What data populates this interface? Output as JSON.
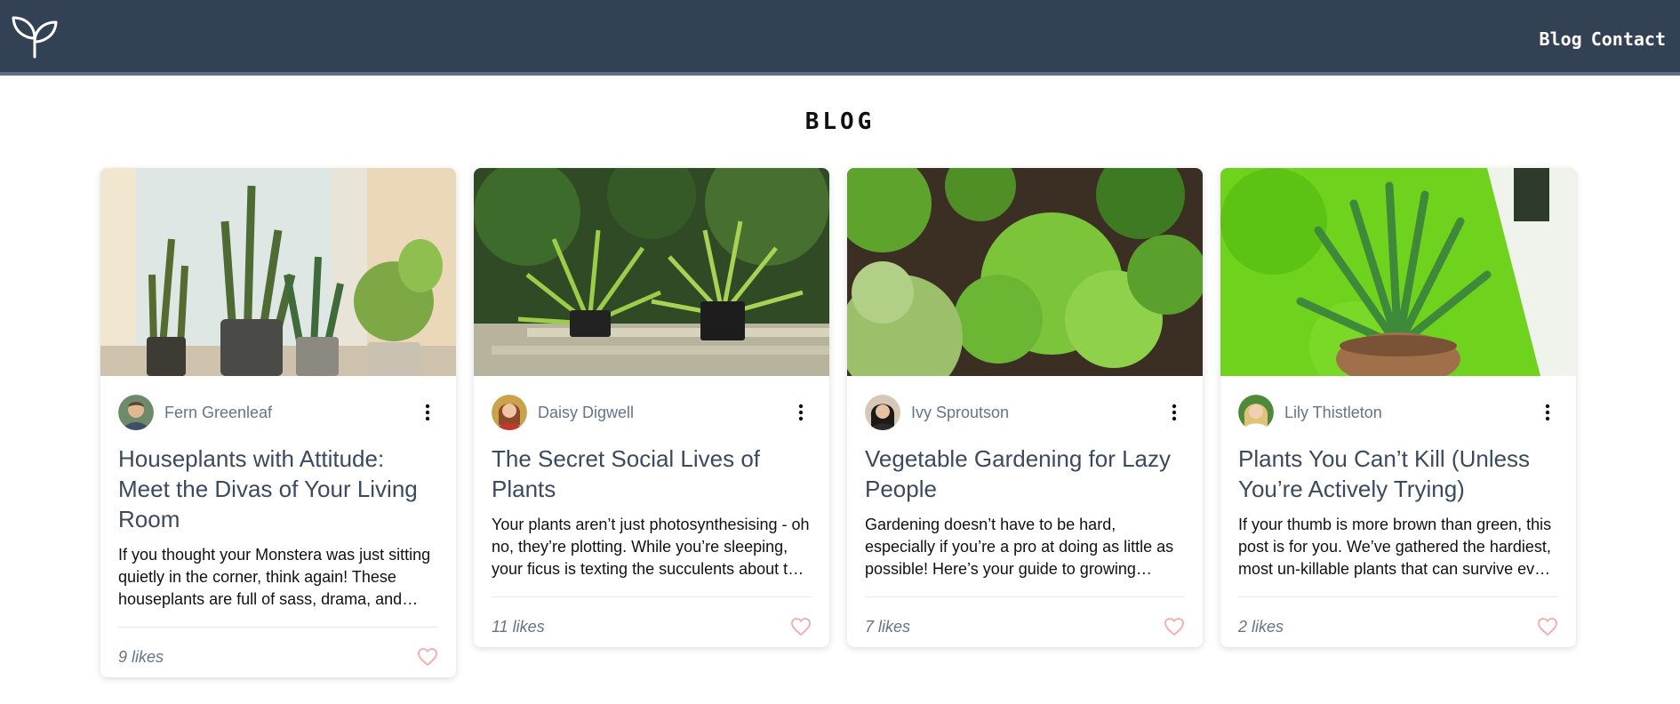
{
  "nav": {
    "logo_icon": "sprout-icon",
    "links": [
      "Blog",
      "Contact"
    ]
  },
  "page": {
    "title": "BLOG"
  },
  "colors": {
    "navbar": "#334155",
    "title_text": "#3b4a5e",
    "muted": "#64748b",
    "heart": "#f4a9a9"
  },
  "posts": [
    {
      "image": "potted-houseplants-by-window-image",
      "author": "Fern Greenleaf",
      "avatar": "man-avatar",
      "title": "Houseplants with Attitude: Meet the Divas of Your Living Room",
      "excerpt": "If you thought your Monstera was just sitting quietly in the corner, think again! These houseplants are full of sass, drama, and attitude.",
      "likes": "9 likes"
    },
    {
      "image": "spider-plants-on-bamboo-image",
      "author": "Daisy Digwell",
      "avatar": "woman-red-avatar",
      "title": "The Secret Social Lives of Plants",
      "excerpt": "Your plants aren’t just photosynthesising - oh no, they’re plotting. While you’re sleeping, your ficus is texting the succulents about that time you forgot to water them.",
      "likes": "11 likes"
    },
    {
      "image": "vegetable-garden-lettuce-image",
      "author": "Ivy Sproutson",
      "avatar": "woman-dark-hair-avatar",
      "title": "Vegetable Gardening for Lazy People",
      "excerpt": "Gardening doesn’t have to be hard, especially if you’re a pro at doing as little as possible! Here’s your guide to growing veggies that practically grow themselves.",
      "likes": "7 likes"
    },
    {
      "image": "aloe-vera-pot-on-grass-image",
      "author": "Lily Thistleton",
      "avatar": "woman-blonde-avatar",
      "title": "Plants You Can’t Kill (Unless You’re Actively Trying)",
      "excerpt": "If your thumb is more brown than green, this post is for you. We’ve gathered the hardiest, most un-killable plants that can survive even the most forgetful owner.",
      "likes": "2 likes"
    }
  ]
}
